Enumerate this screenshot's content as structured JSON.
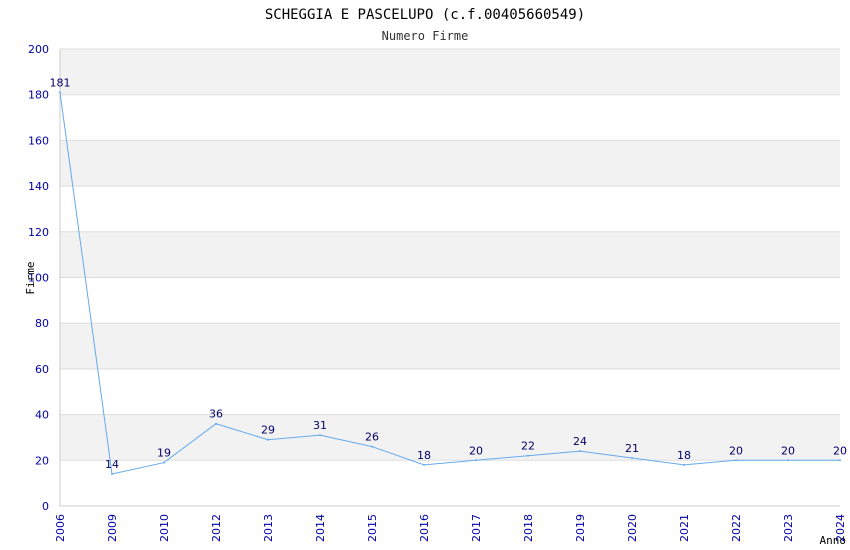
{
  "chart_data": {
    "type": "line",
    "title": "SCHEGGIA E PASCELUPO (c.f.00405660549)",
    "subtitle": "Numero Firme",
    "xlabel": "Anno",
    "ylabel": "Firme",
    "categories": [
      "2006",
      "2009",
      "2010",
      "2012",
      "2013",
      "2014",
      "2015",
      "2016",
      "2017",
      "2018",
      "2019",
      "2020",
      "2021",
      "2022",
      "2023",
      "2024"
    ],
    "series": [
      {
        "values": [
          181,
          14,
          19,
          36,
          29,
          31,
          26,
          18,
          20,
          22,
          24,
          21,
          18,
          20,
          20,
          20
        ]
      }
    ],
    "ylim": [
      0,
      200
    ],
    "yticks": [
      0,
      20,
      40,
      60,
      80,
      100,
      120,
      140,
      160,
      180,
      200
    ],
    "grid": "horizontal-bands",
    "colors": {
      "line": "#66aaee",
      "band": "#f2f2f2",
      "grid": "#dddddd",
      "tick": "#0000aa",
      "label": "#000066"
    }
  }
}
